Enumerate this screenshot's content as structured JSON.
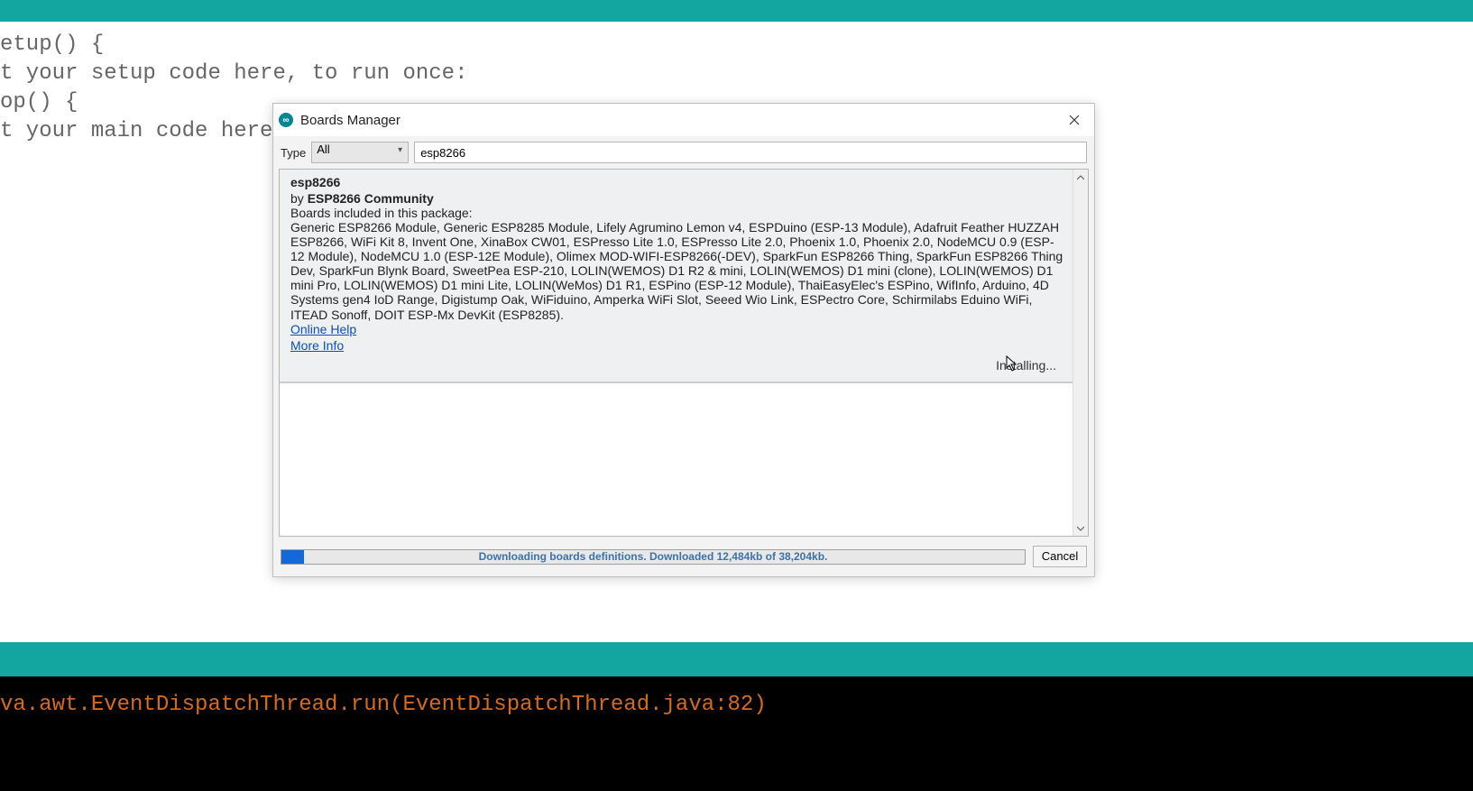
{
  "editor": {
    "code_lines": [
      "etup() {",
      "t your setup code here, to run once:",
      "",
      "",
      "",
      "op() {",
      "t your main code here"
    ]
  },
  "console": {
    "line": "va.awt.EventDispatchThread.run(EventDispatchThread.java:82)"
  },
  "dialog": {
    "title": "Boards Manager",
    "type_label": "Type",
    "type_value": "All",
    "search_value": "esp8266",
    "package": {
      "name": "esp8266",
      "by_prefix": "by ",
      "author": "ESP8266 Community",
      "included_label": "Boards included in this package:",
      "boards": "Generic ESP8266 Module, Generic ESP8285 Module, Lifely Agrumino Lemon v4, ESPDuino (ESP-13 Module), Adafruit Feather HUZZAH ESP8266, WiFi Kit 8, Invent One, XinaBox CW01, ESPresso Lite 1.0, ESPresso Lite 2.0, Phoenix 1.0, Phoenix 2.0, NodeMCU 0.9 (ESP-12 Module), NodeMCU 1.0 (ESP-12E Module), Olimex MOD-WIFI-ESP8266(-DEV), SparkFun ESP8266 Thing, SparkFun ESP8266 Thing Dev, SparkFun Blynk Board, SweetPea ESP-210, LOLIN(WEMOS) D1 R2 & mini, LOLIN(WEMOS) D1 mini (clone), LOLIN(WEMOS) D1 mini Pro, LOLIN(WEMOS) D1 mini Lite, LOLIN(WeMos) D1 R1, ESPino (ESP-12 Module), ThaiEasyElec's ESPino, WifInfo, Arduino, 4D Systems gen4 IoD Range, Digistump Oak, WiFiduino, Amperka WiFi Slot, Seeed Wio Link, ESPectro Core, Schirmilabs Eduino WiFi, ITEAD Sonoff, DOIT ESP-Mx DevKit (ESP8285).",
      "online_help": "Online Help",
      "more_info": "More Info",
      "installing": "Installing..."
    },
    "progress": {
      "text": "Downloading boards definitions. Downloaded 12,484kb of 38,204kb.",
      "cancel": "Cancel"
    }
  }
}
